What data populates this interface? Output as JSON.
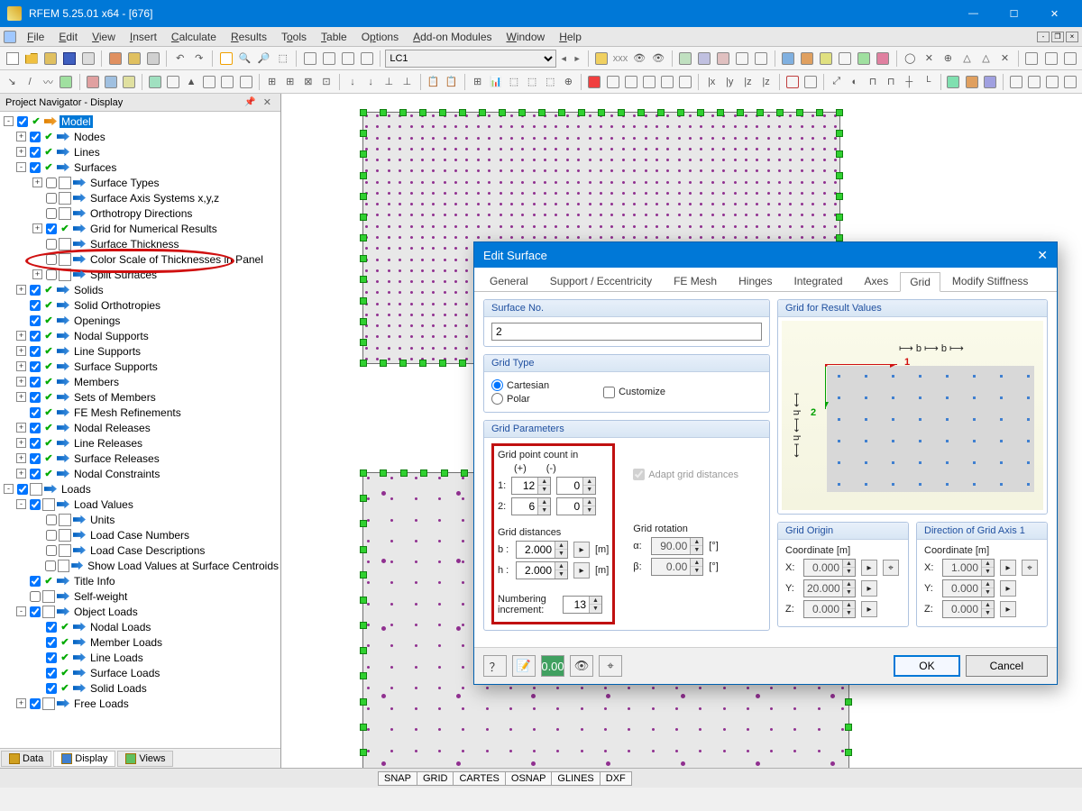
{
  "title": "RFEM 5.25.01 x64 - [676]",
  "menus": [
    "File",
    "Edit",
    "View",
    "Insert",
    "Calculate",
    "Results",
    "Tools",
    "Table",
    "Options",
    "Add-on Modules",
    "Window",
    "Help"
  ],
  "combo": "LC1",
  "navigator": {
    "title": "Project Navigator - Display",
    "tabs": [
      "Data",
      "Display",
      "Views"
    ],
    "active_tab": "Display",
    "highlighted": "Grid for Numerical Results",
    "items": {
      "model": "Model",
      "nodes": "Nodes",
      "lines": "Lines",
      "surfaces": "Surfaces",
      "surface_types": "Surface Types",
      "surface_axis": "Surface Axis Systems x,y,z",
      "ortho": "Orthotropy Directions",
      "grid": "Grid for Numerical Results",
      "thickness": "Surface Thickness",
      "colorscale": "Color Scale of Thicknesses in Panel",
      "split": "Split Surfaces",
      "solids": "Solids",
      "solid_ortho": "Solid Orthotropies",
      "openings": "Openings",
      "nodal_sup": "Nodal Supports",
      "line_sup": "Line Supports",
      "surf_sup": "Surface Supports",
      "members": "Members",
      "sets": "Sets of Members",
      "fe_ref": "FE Mesh Refinements",
      "nodal_rel": "Nodal Releases",
      "line_rel": "Line Releases",
      "surf_rel": "Surface Releases",
      "nodal_con": "Nodal Constraints",
      "loads": "Loads",
      "load_values": "Load Values",
      "units": "Units",
      "lcnum": "Load Case Numbers",
      "lcdesc": "Load Case Descriptions",
      "showvals": "Show Load Values at Surface Centroids",
      "titleinfo": "Title Info",
      "selfw": "Self-weight",
      "obj_loads": "Object Loads",
      "nl": "Nodal Loads",
      "ml": "Member Loads",
      "ll": "Line Loads",
      "sl": "Surface Loads",
      "sol": "Solid Loads",
      "free": "Free Loads"
    }
  },
  "dialog": {
    "title": "Edit Surface",
    "tabs": [
      "General",
      "Support / Eccentricity",
      "FE Mesh",
      "Hinges",
      "Integrated",
      "Axes",
      "Grid",
      "Modify Stiffness"
    ],
    "active_tab": "Grid",
    "surface_no_label": "Surface No.",
    "surface_no": "2",
    "gridtype_label": "Grid Type",
    "cartesian": "Cartesian",
    "polar": "Polar",
    "customize": "Customize",
    "gridparams_label": "Grid Parameters",
    "grid_point_count": "Grid point count in",
    "plus": "(+)",
    "minus": "(-)",
    "r1": "1:",
    "r2": "2:",
    "v1p": "12",
    "v1m": "0",
    "v2p": "6",
    "v2m": "0",
    "grid_dist": "Grid distances",
    "b": "b :",
    "h": "h :",
    "bval": "2.000",
    "hval": "2.000",
    "m": "[m]",
    "numbering": "Numbering increment:",
    "numval": "13",
    "adapt": "Adapt grid distances",
    "rot": "Grid rotation",
    "alpha": "α:",
    "beta": "β:",
    "aval": "90.00",
    "bvalr": "0.00",
    "deg": "[°]",
    "preview_title": "Grid for Result Values",
    "origin": "Grid Origin",
    "coord": "Coordinate [m]",
    "X": "X:",
    "Y": "Y:",
    "Z": "Z:",
    "ox": "0.000",
    "oy": "20.000",
    "oz": "0.000",
    "axis1": "Direction of Grid Axis 1",
    "ax": "1.000",
    "ay": "0.000",
    "az": "0.000",
    "ok": "OK",
    "cancel": "Cancel"
  },
  "status": [
    "SNAP",
    "GRID",
    "CARTES",
    "OSNAP",
    "GLINES",
    "DXF"
  ]
}
